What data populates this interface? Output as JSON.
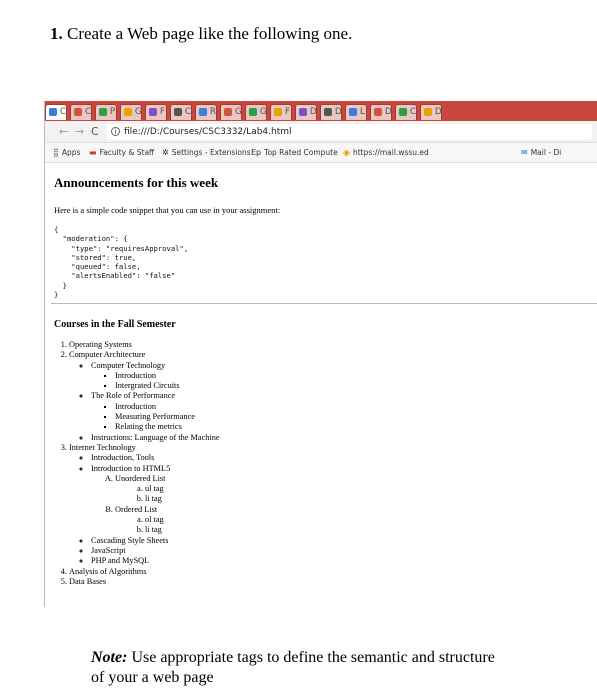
{
  "question": {
    "number": "1.",
    "text": "Create a Web page like the following one."
  },
  "browser": {
    "tabs": [
      "C",
      "C",
      "P",
      "G",
      "F",
      "C",
      "R",
      "G",
      "G",
      "F",
      "D",
      "D",
      "L",
      "D",
      "C",
      "D"
    ],
    "url": "file:///D:/Courses/CSC3332/Lab4.html",
    "bookmarks": {
      "apps": "Apps",
      "faculty": "Faculty & Staff",
      "settings": "Settings - Extensions",
      "toprated": "Top Rated Compute",
      "mail1": "https://mail.wssu.ed",
      "mail2": "Mail - Di"
    }
  },
  "page": {
    "announcements_title": "Announcements for this week",
    "intro": "Here is a simple code snippet that you can use in your assignment:",
    "code": "{\n  \"moderation\": {\n    \"type\": \"requiresApproval\",\n    \"stored\": true,\n    \"queued\": false,\n    \"alertsEnabled\": \"false\"\n  }\n}",
    "courses_title": "Courses in the Fall Semester",
    "courses": {
      "os": "Operating Systems",
      "arch": "Computer Architecture",
      "comp_tech": "Computer Technology",
      "intro1": "Introduction",
      "circuits": "Intergrated Circuits",
      "perf_role": "The Role of Performance",
      "intro2": "Introduction",
      "measuring": "Measuring Performance",
      "relating": "Relating the metrics",
      "instructions": "Instructions: Language of the Machine",
      "internet": "Internet Technology",
      "intro_tools": "Introduction, Tools",
      "html5": "Introduction to HTML5",
      "unordered": "Unordered List",
      "ul_tag": "ul tag",
      "li_tag1": "li tag",
      "ordered": "Ordered List",
      "ol_tag": "ol tag",
      "li_tag2": "li tag",
      "css": "Cascading Style Sheets",
      "js": "JavaScript",
      "php": "PHP and MySQL",
      "algorithms": "Analysis of Algorithms",
      "databases": "Data Bases"
    }
  },
  "note": {
    "label": "Note:",
    "text": " Use appropriate tags to define the semantic and structure of your a web page"
  },
  "colors": {
    "tabstrip": "#c9473d",
    "tab": "#e9c8c3"
  }
}
